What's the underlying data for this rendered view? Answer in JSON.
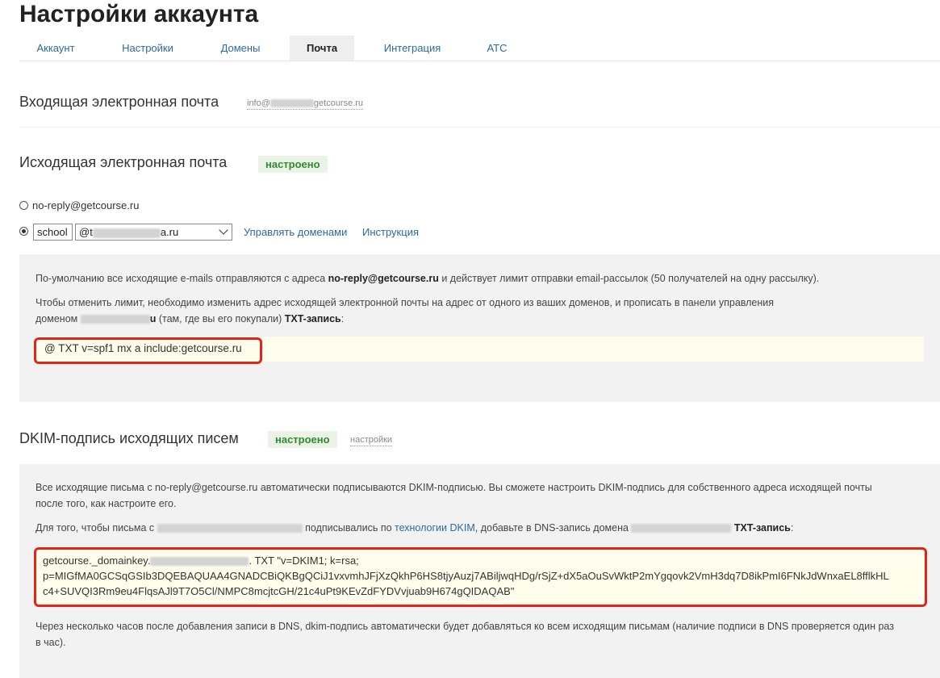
{
  "page": {
    "title": "Настройки аккаунта"
  },
  "tabs": [
    {
      "label": "Аккаунт"
    },
    {
      "label": "Настройки"
    },
    {
      "label": "Домены"
    },
    {
      "label": "Почта"
    },
    {
      "label": "Интеграция"
    },
    {
      "label": "АТС"
    }
  ],
  "incoming": {
    "title": "Входящая электронная почта",
    "email_prefix": "info@",
    "email_suffix": "getcourse.ru"
  },
  "outgoing": {
    "title": "Исходящая электронная почта",
    "badge": "настроено",
    "option_default": "no-reply@getcourse.ru",
    "local_part": "school",
    "domain_prefix": "@t",
    "domain_suffix": "a.ru",
    "manage_domains": "Управлять доменами",
    "instruction": "Инструкция",
    "p1_before": "По-умолчанию все исходящие e-mails отправляются с адреса ",
    "p1_bold": "no-reply@getcourse.ru",
    "p1_after": " и действует лимит отправки email-рассылок (50 получателей на одну рассылку).",
    "p2_line1": "Чтобы отменить лимит, необходимо изменить адрес исходящей электронной почты на адрес от одного из ваших доменов, и прописать в панели управления",
    "p2_before": "доменом ",
    "p2_mid": "u",
    "p2_after": " (там, где вы его покупали) ",
    "p2_bold": "TXT-запись",
    "p2_end": ":",
    "txt_record": "@ TXT v=spf1 mx a include:getcourse.ru"
  },
  "dkim": {
    "title": "DKIM-подпись исходящих писем",
    "badge": "настроено",
    "settings_link": "настройки",
    "p1": "Все исходящие письма с no-reply@getcourse.ru автоматически подписываются DKIM-подписью. Вы сможете настроить DKIM-подпись для собственного адреса исходящей почты после того, как настроите его.",
    "p2_before": "Для того, чтобы письма с ",
    "p2_mid": " подписывались по ",
    "p2_link": "технологии DKIM",
    "p2_after": ", добавьте в DNS-запись домена ",
    "p2_bold": "TXT-запись",
    "p2_end": ":",
    "record_line1_before": "getcourse._domainkey.",
    "record_line1_after": ". TXT \"v=DKIM1; k=rsa;",
    "record_line2": "p=MIGfMA0GCSqGSIb3DQEBAQUAA4GNADCBiQKBgQCiJ1vxvmhJFjXzQkhP6HS8tjyAuzj7ABiljwqHDg/rSjZ+dX5aOuSvWktP2mYgqovk2VmH3dq7D8ikPmI6FNkJdWnxaEL8fflkHL",
    "record_line3": "c4+SUVQI3Rm9eu4FlqsAJl9T7O5Cl/NMPC8mcjtcGH/21c4uPt9KEvZdFYDVvjuab9H674gQIDAQAB\"",
    "p3": "Через несколько часов после добавления записи в DNS, dkim-подпись автоматически будет добавляться ко всем исходящим письмам (наличие подписи в DNS проверяется один раз в час)."
  },
  "colors": {
    "link": "#2c6a9e",
    "badge_text": "#2e8b2e",
    "highlight": "#e0251b",
    "code_bg": "#fffdeb",
    "panel_bg": "#f2f2f2"
  }
}
